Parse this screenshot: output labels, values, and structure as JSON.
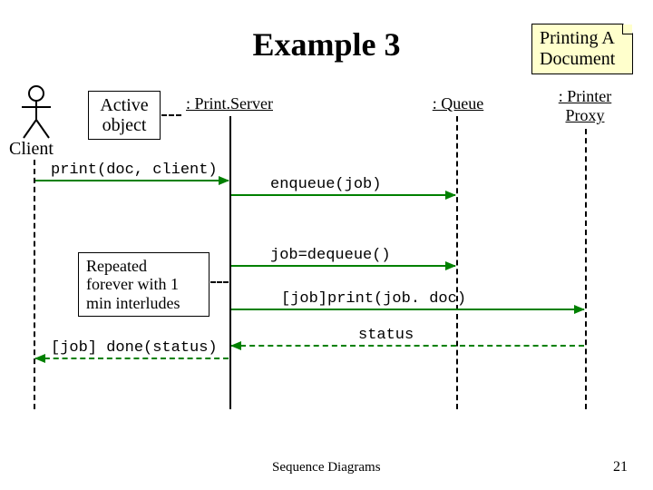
{
  "title": "Example 3",
  "note_printing": "Printing A\nDocument",
  "note_active": "Active\nobject",
  "note_repeated": "Repeated\nforever with 1\nmin interludes",
  "lifelines": {
    "client": "Client",
    "printserver": ": Print.Server",
    "queue": ": Queue",
    "printerproxy": ": Printer\nProxy"
  },
  "messages": {
    "print": "print(doc, client)",
    "enqueue": "enqueue(job)",
    "dequeue": "job=dequeue()",
    "printjob": "[job]print(job. doc)",
    "status": "status",
    "done": "[job] done(status)"
  },
  "footer": "Sequence Diagrams",
  "page": "21"
}
